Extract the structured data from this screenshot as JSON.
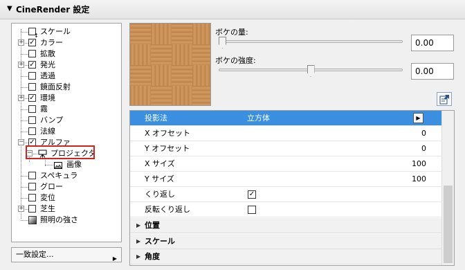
{
  "header": {
    "title": "CineRender 設定"
  },
  "tree": {
    "items": [
      {
        "label": "スケール",
        "checked": false,
        "expander": ""
      },
      {
        "label": "カラー",
        "checked": true,
        "expander": "+"
      },
      {
        "label": "拡散",
        "checked": false,
        "expander": ""
      },
      {
        "label": "発光",
        "checked": true,
        "expander": "+"
      },
      {
        "label": "透過",
        "checked": false,
        "expander": ""
      },
      {
        "label": "鏡面反射",
        "checked": false,
        "expander": ""
      },
      {
        "label": "環境",
        "checked": true,
        "expander": "+"
      },
      {
        "label": "霧",
        "checked": false,
        "expander": ""
      },
      {
        "label": "バンプ",
        "checked": false,
        "expander": ""
      },
      {
        "label": "法線",
        "checked": false,
        "expander": ""
      },
      {
        "label": "アルファ",
        "checked": true,
        "expander": "-"
      },
      {
        "label": "プロジェクタ"
      },
      {
        "label": "画像"
      },
      {
        "label": "スペキュラ",
        "checked": false,
        "expander": ""
      },
      {
        "label": "グロー",
        "checked": false,
        "expander": ""
      },
      {
        "label": "変位",
        "checked": false,
        "expander": ""
      },
      {
        "label": "芝生",
        "checked": false,
        "expander": "+"
      },
      {
        "label": "照明の強さ"
      }
    ]
  },
  "dropdown": {
    "label": "一致設定..."
  },
  "sliders": {
    "bokeh_amount": {
      "label": "ボケの量:",
      "value": "0.00",
      "level": 0
    },
    "bokeh_strength": {
      "label": "ボケの強度:",
      "value": "0.00",
      "level": 0.5
    }
  },
  "properties": {
    "rows": [
      {
        "name": "投影法",
        "value": "立方体",
        "selected": true
      },
      {
        "name": "X オフセット",
        "number": "0"
      },
      {
        "name": "Y オフセット",
        "number": "0"
      },
      {
        "name": "X サイズ",
        "number": "100"
      },
      {
        "name": "Y サイズ",
        "number": "100"
      },
      {
        "name": "くり返し",
        "checked": true
      },
      {
        "name": "反転くり返し",
        "checked": false
      }
    ],
    "groups": [
      "位置",
      "スケール",
      "角度"
    ]
  },
  "colors": {
    "selection": "#3a8fe0",
    "highlight_border": "#d32020"
  },
  "icons": {
    "header_toggle": "triangle-down-icon",
    "dropdown_arrow": "triangle-right-icon",
    "edit": "edit-document-icon",
    "projector": "projector-icon",
    "image": "image-icon"
  }
}
